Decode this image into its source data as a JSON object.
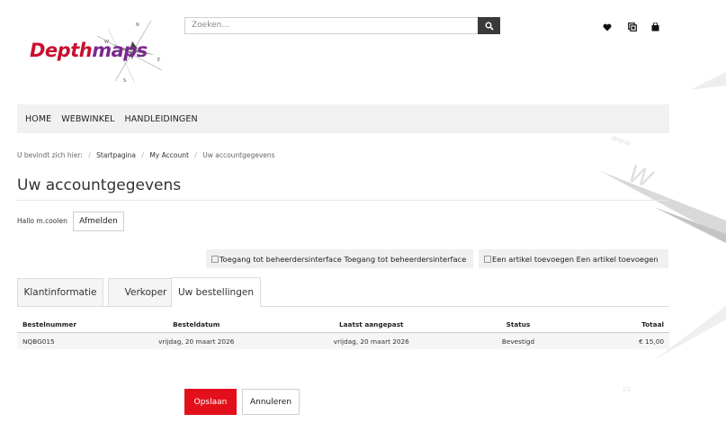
{
  "colors": {
    "brand_red": "#c8102e",
    "brand_purple": "#7a2a8c",
    "accent_red": "#e3101b",
    "search_button": "#3a3a3a",
    "nav_bg": "#f1f1f1"
  },
  "logo": {
    "text_part1": "Depth",
    "text_part2": "maps",
    "icon": "compass-rose-icon"
  },
  "search": {
    "placeholder": "Zoeken...",
    "icon": "search-icon"
  },
  "header_icons": [
    "heart-icon",
    "compare-icon",
    "shopping-bag-icon"
  ],
  "nav": {
    "items": [
      "HOME",
      "WEBWINKEL",
      "HANDLEIDINGEN"
    ]
  },
  "breadcrumb": {
    "prefix": "U bevindt zich hier:",
    "items": [
      "Startpagina",
      "My Account",
      "Uw accountgegevens"
    ]
  },
  "page": {
    "title": "Uw accountgegevens",
    "greeting": "Hallo m.coolen",
    "logout_label": "Afmelden"
  },
  "admin_buttons": [
    {
      "alt": "Toegang tot beheerdersinterface",
      "label": "Toegang tot beheerdersinterface"
    },
    {
      "alt": "Een artikel toevoegen",
      "label": "Een artikel toevoegen"
    }
  ],
  "tabs": [
    {
      "label": "Klantinformatie",
      "active": false
    },
    {
      "label": "Verkoper",
      "active": false
    },
    {
      "label": "Uw bestellingen",
      "active": true
    }
  ],
  "orders": {
    "headers": [
      "Bestelnummer",
      "Besteldatum",
      "Laatst aangepast",
      "Status",
      "Totaal"
    ],
    "rows": [
      {
        "number": "NQBG015",
        "date": "vrijdag, 20 maart 2026",
        "modified": "vrijdag, 20 maart 2026",
        "status": "Bevestigd",
        "total": "€ 15,00"
      }
    ]
  },
  "form_buttons": {
    "save": "Opslaan",
    "cancel": "Annuleren"
  }
}
